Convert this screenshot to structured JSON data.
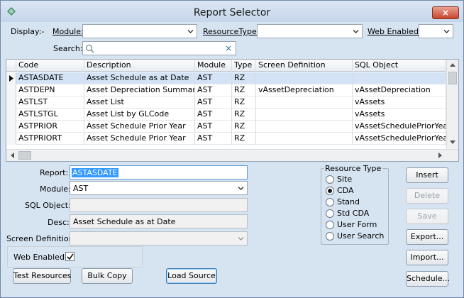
{
  "window": {
    "title": "Report Selector",
    "close_glyph": "×"
  },
  "filters": {
    "display_label": "Display:-",
    "module_label": "Module:",
    "module_value": "",
    "resourcetype_label": "ResourceType:",
    "resourcetype_value": "",
    "web_enabled_label": "Web Enabled:",
    "web_enabled_value": "",
    "search_label": "Search:",
    "search_value": "",
    "clear_glyph": "×"
  },
  "grid": {
    "columns": [
      "Code",
      "Description",
      "Module",
      "Type",
      "Screen Definition",
      "SQL Object"
    ],
    "rows": [
      [
        "ASTASDATE",
        "Asset Schedule as at Date",
        "AST",
        "RZ",
        "",
        ""
      ],
      [
        "ASTDEPN",
        "Asset Depreciation Summary",
        "AST",
        "RZ",
        "vAssetDepreciation",
        "vAssetDepreciation"
      ],
      [
        "ASTLST",
        "Asset List",
        "AST",
        "RZ",
        "",
        "vAssets"
      ],
      [
        "ASTLSTGL",
        "Asset List by GLCode",
        "AST",
        "RZ",
        "",
        "vAssets"
      ],
      [
        "ASTPRIOR",
        "Asset Schedule Prior Year",
        "AST",
        "RZ",
        "",
        "vAssetSchedulePriorYear"
      ],
      [
        "ASTPRIORT",
        "Asset Schedule Prior Year",
        "AST",
        "RZ",
        "",
        "vAssetSchedulePriorYear"
      ]
    ],
    "selected_row": 0
  },
  "form": {
    "report_label": "Report:",
    "report_value": "ASTASDATE",
    "module_label": "Module:",
    "module_value": "AST",
    "sql_label": "SQL Object:",
    "sql_value": "",
    "desc_label": "Desc:",
    "desc_value": "Asset Schedule as at Date",
    "screen_label": "Screen Definition:",
    "screen_value": "",
    "web_label": "Web Enabled:",
    "web_checked": true
  },
  "resource_type": {
    "title": "Resource Type",
    "options": [
      "Site",
      "CDA",
      "Stand",
      "Std CDA",
      "User Form",
      "User Search"
    ],
    "selected": "CDA"
  },
  "buttons": {
    "insert": "Insert",
    "delete": "Delete",
    "save": "Save",
    "export": "Export...",
    "import": "Import...",
    "schedule": "Schedule...",
    "test_resources": "Test Resources",
    "bulk_copy": "Bulk Copy",
    "load_source": "Load Source"
  },
  "colors": {
    "accent": "#3399ff",
    "selected_row": "#d3e3f5"
  }
}
